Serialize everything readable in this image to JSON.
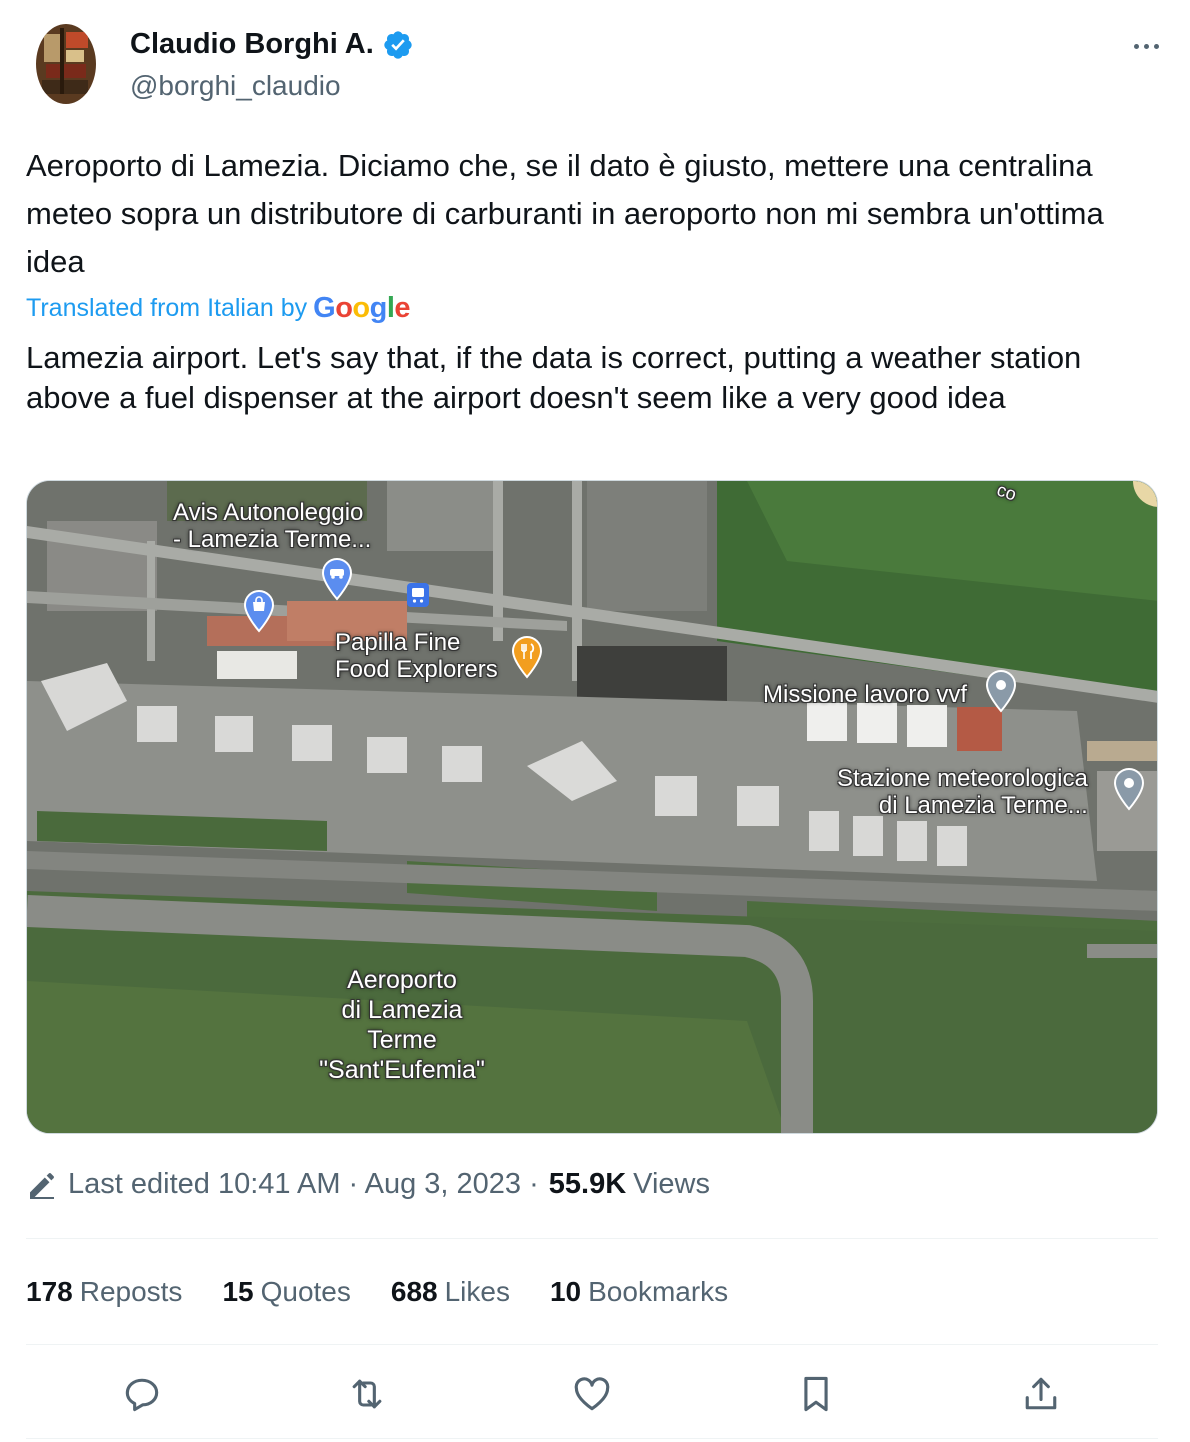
{
  "author": {
    "display_name": "Claudio Borghi A.",
    "handle": "@borghi_claudio",
    "verified_color": "#1d9bf0"
  },
  "tweet": {
    "text": "Aeroporto di Lamezia. Diciamo che, se il dato è giusto, mettere una centralina meteo sopra un distributore di carburanti in aeroporto non mi sembra un'ottima idea",
    "translated_label": "Translated from Italian by",
    "translator": "Google",
    "translation": "Lamezia airport. Let's say that, if the data is correct, putting a weather station above a fuel dispenser at the airport doesn't seem like a very good idea"
  },
  "map": {
    "labels": {
      "avis": "Avis Autonoleggio\n- Lamezia Terme...",
      "papilla": "Papilla Fine\nFood Explorers",
      "missione": "Missione lavoro vvf",
      "stazione": "Stazione meteorologica\ndi Lamezia Terme...",
      "aeroporto": "Aeroporto\ndi Lamezia\nTerme\n\"Sant'Eufemia\"",
      "corner": "co"
    },
    "icons": [
      "car-rental-pin-icon",
      "shopping-pin-icon",
      "bus-stop-icon",
      "restaurant-pin-icon",
      "place-pin-icon",
      "place-pin-icon"
    ]
  },
  "meta": {
    "edited": "Last edited 10:41 AM · Aug 3, 2023 ·",
    "views_count": "55.9K",
    "views_label": "Views"
  },
  "stats": {
    "reposts_count": "178",
    "reposts_label": "Reposts",
    "quotes_count": "15",
    "quotes_label": "Quotes",
    "likes_count": "688",
    "likes_label": "Likes",
    "bookmarks_count": "10",
    "bookmarks_label": "Bookmarks"
  },
  "actions": [
    "reply-icon",
    "repost-icon",
    "like-icon",
    "bookmark-icon",
    "share-icon"
  ],
  "colors": {
    "accent": "#1d9bf0",
    "text_primary": "#0f1419",
    "text_secondary": "#536471"
  }
}
